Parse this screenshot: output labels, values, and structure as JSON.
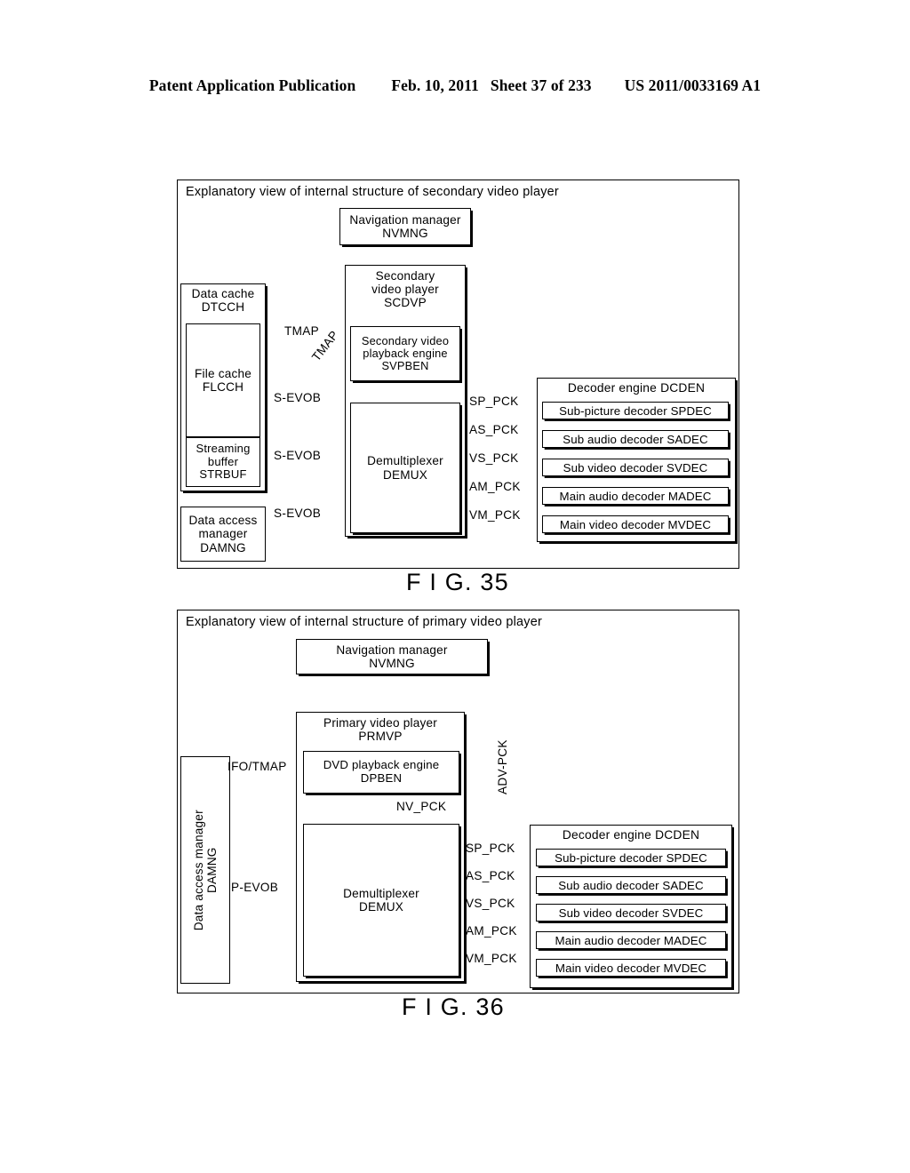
{
  "header": {
    "publication": "Patent Application Publication",
    "date": "Feb. 10, 2011",
    "sheet": "Sheet 37 of 233",
    "number": "US 2011/0033169 A1"
  },
  "figures": [
    {
      "id": "fig35",
      "caption": "F I G. 35",
      "title": "Explanatory view of internal structure of secondary video player",
      "blocks": {
        "nav_manager": {
          "line1": "Navigation manager",
          "line2": "NVMNG"
        },
        "secondary_video_player": {
          "line1": "Secondary",
          "line2": "video player",
          "line3": "SCDVP"
        },
        "svpben": {
          "line1": "Secondary video",
          "line2": "playback engine",
          "line3": "SVPBEN"
        },
        "data_cache": {
          "line1": "Data cache",
          "line2": "DTCCH"
        },
        "file_cache": {
          "line1": "File cache",
          "line2": "FLCCH"
        },
        "streaming_buffer": {
          "line1": "Streaming",
          "line2": "buffer",
          "line3": "STRBUF"
        },
        "data_access_manager": {
          "line1": "Data access",
          "line2": "manager",
          "line3": "DAMNG"
        },
        "demux": {
          "line1": "Demultiplexer",
          "line2": "DEMUX"
        },
        "decoder_engine_title": "Decoder engine DCDEN"
      },
      "decoders": [
        "Sub-picture decoder SPDEC",
        "Sub audio decoder SADEC",
        "Sub video decoder SVDEC",
        "Main audio decoder MADEC",
        "Main video decoder MVDEC"
      ],
      "packet_labels": [
        "SP_PCK",
        "AS_PCK",
        "VS_PCK",
        "AM_PCK",
        "VM_PCK"
      ],
      "connector_labels": {
        "tmap_top": "TMAP",
        "tmap_diag": "TMAP",
        "sevob_1": "S-EVOB",
        "sevob_2": "S-EVOB",
        "sevob_3": "S-EVOB"
      }
    },
    {
      "id": "fig36",
      "caption": "F I G. 36",
      "title": "Explanatory view of internal structure of primary video player",
      "blocks": {
        "nav_manager": {
          "line1": "Navigation manager",
          "line2": "NVMNG"
        },
        "primary_video_player": {
          "line1": "Primary video player",
          "line2": "PRMVP"
        },
        "dpben": {
          "line1": "DVD playback engine",
          "line2": "DPBEN"
        },
        "data_access_manager": {
          "line1": "Data access manager",
          "line2": "DAMNG"
        },
        "demux": {
          "line1": "Demultiplexer",
          "line2": "DEMUX"
        },
        "decoder_engine_title": "Decoder engine DCDEN"
      },
      "decoders": [
        "Sub-picture decoder SPDEC",
        "Sub audio decoder SADEC",
        "Sub video decoder SVDEC",
        "Main audio decoder MADEC",
        "Main video decoder MVDEC"
      ],
      "packet_labels": [
        "SP_PCK",
        "AS_PCK",
        "VS_PCK",
        "AM_PCK",
        "VM_PCK"
      ],
      "connector_labels": {
        "ifo_tmap": "IFO/TMAP",
        "pevob": "P-EVOB",
        "nv_pck": "NV_PCK",
        "adv_pck": "ADV-PCK"
      }
    }
  ]
}
